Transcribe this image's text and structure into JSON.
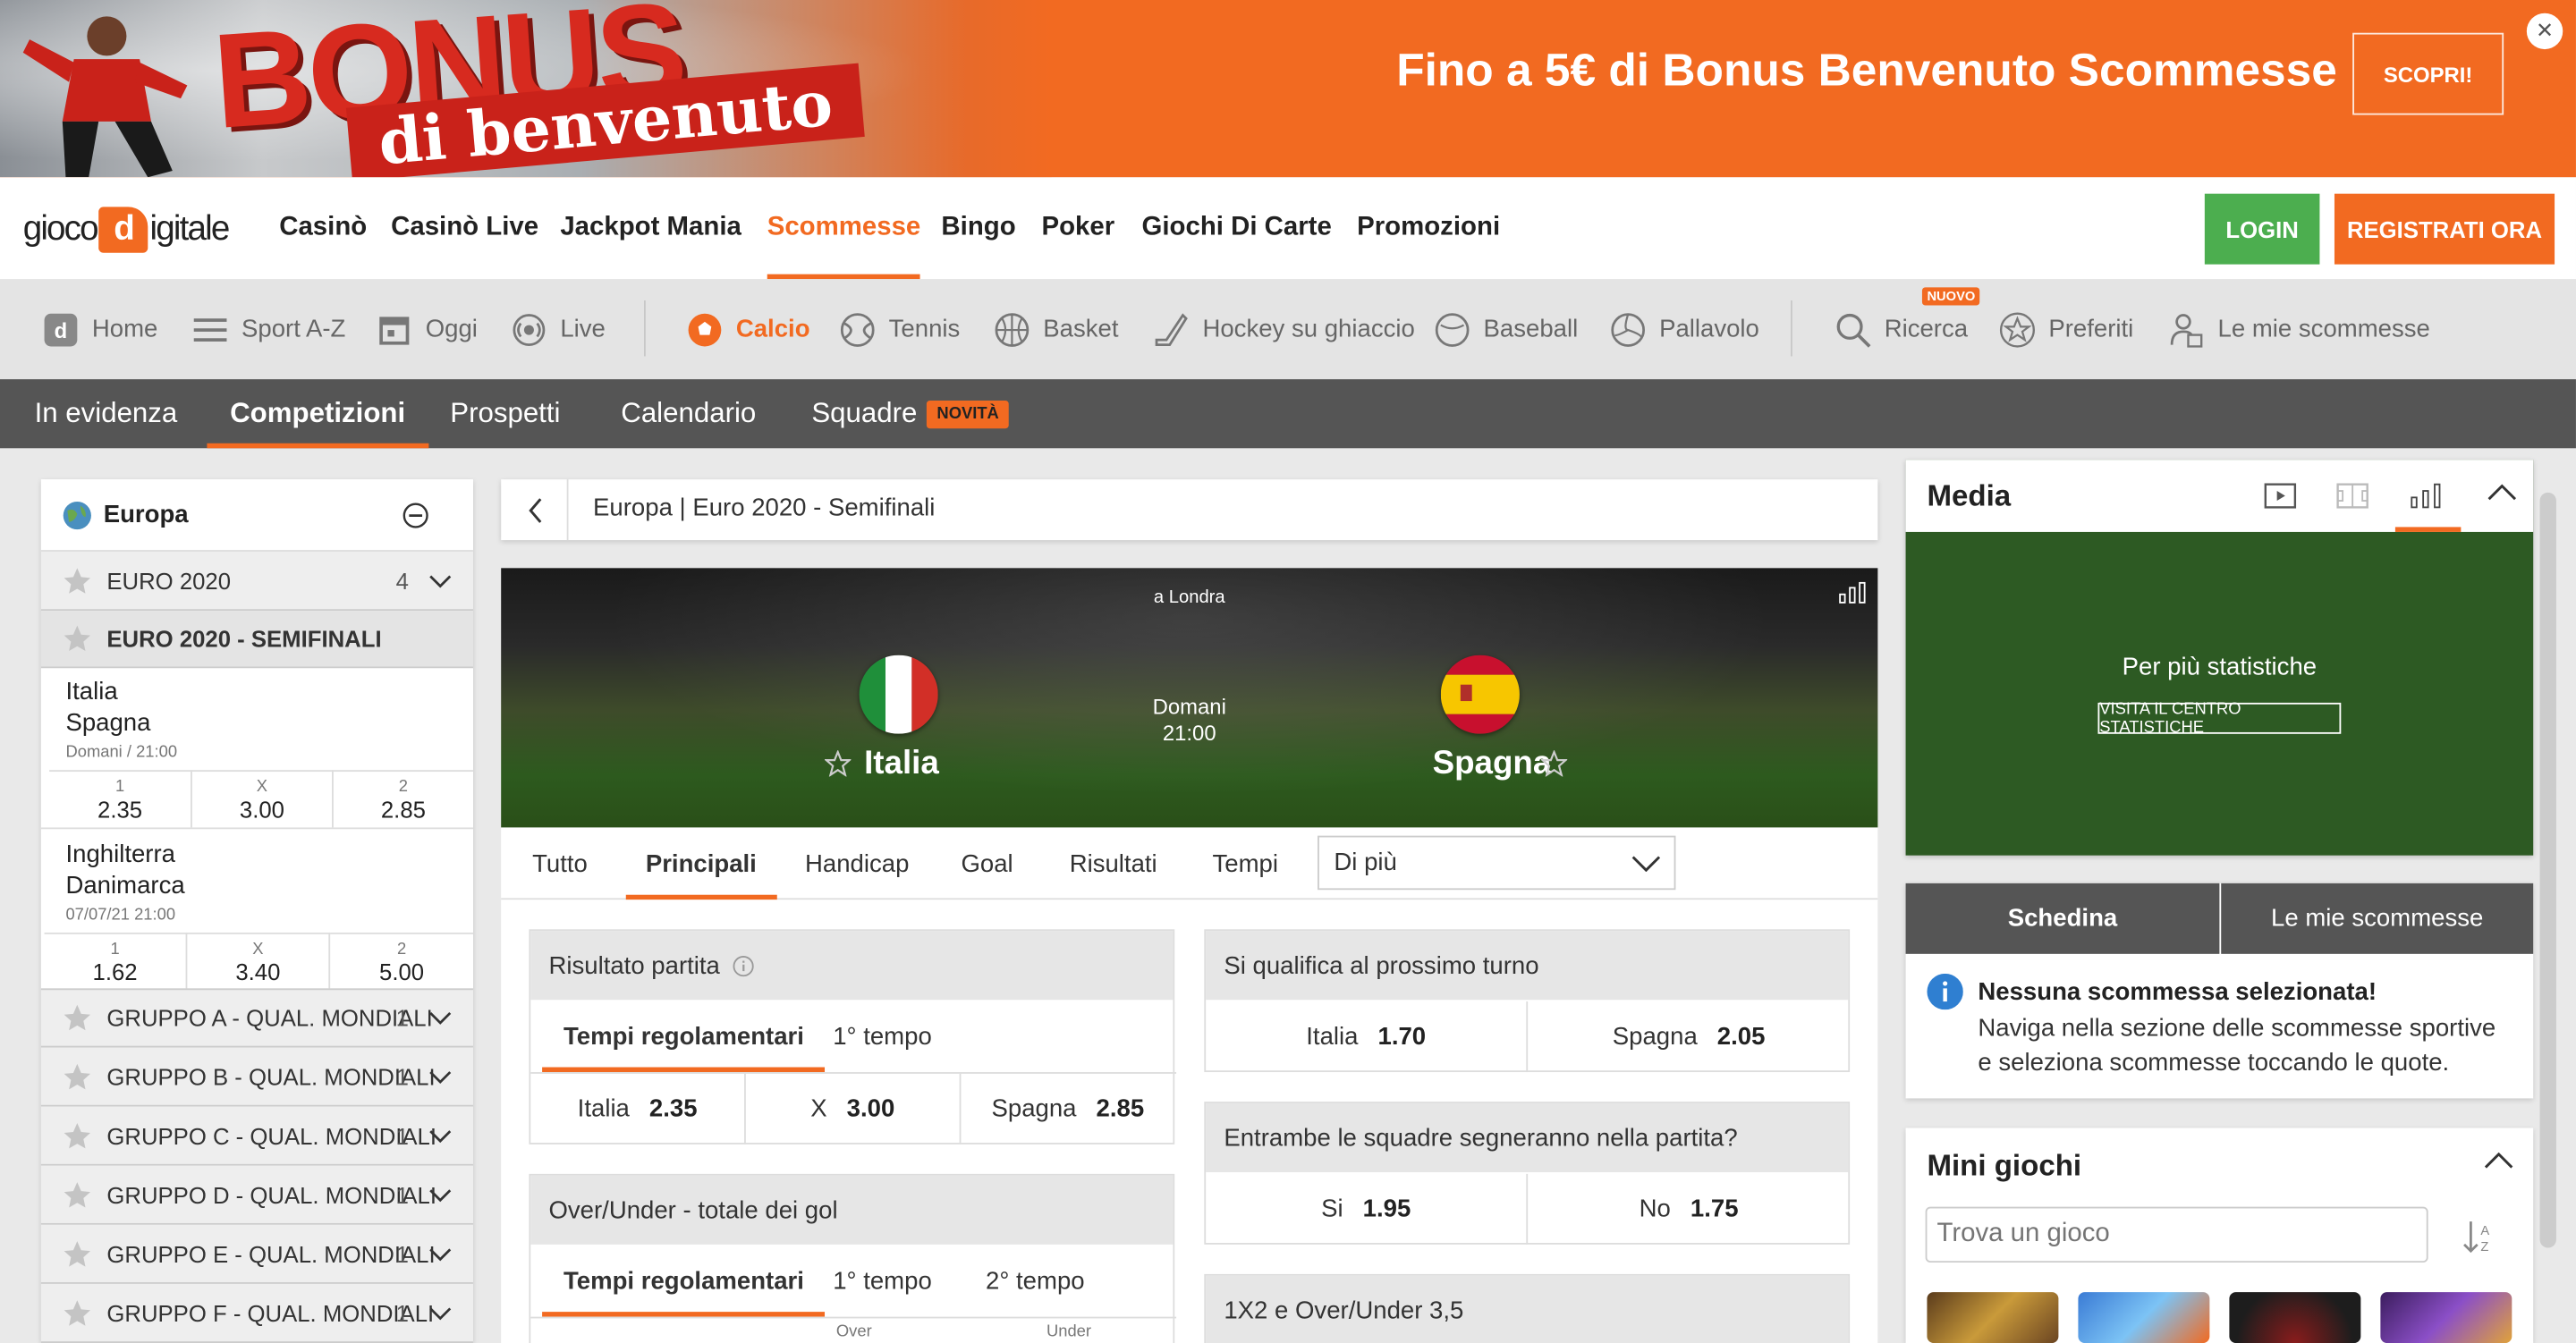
{
  "banner": {
    "title": "Fino a 5€ di Bonus Benvenuto Scommesse",
    "cta": "SCOPRI!",
    "image_big": "BONUS",
    "image_sub": "di benvenuto",
    "close_icon": "close-icon"
  },
  "logo": {
    "part1": "gioco",
    "d": "d",
    "part2": "igitale"
  },
  "main_nav": [
    "Casinò",
    "Casinò Live",
    "Jackpot Mania",
    "Scommesse",
    "Bingo",
    "Poker",
    "Giochi Di Carte",
    "Promozioni"
  ],
  "auth": {
    "login": "LOGIN",
    "register": "REGISTRATI ORA"
  },
  "sport_nav": [
    "Home",
    "Sport A-Z",
    "Oggi",
    "Live",
    "Calcio",
    "Tennis",
    "Basket",
    "Hockey su ghiaccio",
    "Baseball",
    "Pallavolo",
    "Ricerca",
    "Preferiti",
    "Le mie scommesse"
  ],
  "sport_badge": "NUOVO",
  "sub_nav": [
    "In evidenza",
    "Competizioni",
    "Prospetti",
    "Calendario",
    "Squadre"
  ],
  "sub_badge": "NOVITÀ",
  "sidebar": {
    "region": "Europa",
    "comp1": {
      "label": "EURO 2020",
      "count": "4"
    },
    "comp2": {
      "label": "EURO 2020 - SEMIFINALI"
    },
    "matches": [
      {
        "home": "Italia",
        "away": "Spagna",
        "time": "Domani / 21:00",
        "odds": [
          {
            "k": "1",
            "v": "2.35"
          },
          {
            "k": "X",
            "v": "3.00"
          },
          {
            "k": "2",
            "v": "2.85"
          }
        ]
      },
      {
        "home": "Inghilterra",
        "away": "Danimarca",
        "time": "07/07/21 21:00",
        "odds": [
          {
            "k": "1",
            "v": "1.62"
          },
          {
            "k": "X",
            "v": "3.40"
          },
          {
            "k": "2",
            "v": "5.00"
          }
        ]
      }
    ],
    "groups": [
      {
        "label": "GRUPPO A - QUAL. MONDIALI",
        "count": "1"
      },
      {
        "label": "GRUPPO B - QUAL. MONDIALI",
        "count": "1"
      },
      {
        "label": "GRUPPO C - QUAL. MONDIALI",
        "count": "1"
      },
      {
        "label": "GRUPPO D - QUAL. MONDIALI",
        "count": "1"
      },
      {
        "label": "GRUPPO E - QUAL. MONDIALI",
        "count": "1"
      },
      {
        "label": "GRUPPO F - QUAL. MONDIALI",
        "count": "1"
      }
    ]
  },
  "breadcrumb": "Europa | Euro 2020 - Semifinali",
  "event": {
    "venue": "a Londra",
    "home": "Italia",
    "away": "Spagna",
    "day": "Domani",
    "time": "21:00"
  },
  "market_tabs": [
    "Tutto",
    "Principali",
    "Handicap",
    "Goal",
    "Risultati",
    "Tempi"
  ],
  "more_select": "Di più",
  "markets": {
    "result": {
      "title": "Risultato partita",
      "tabs": [
        "Tempi regolamentari",
        "1° tempo"
      ],
      "sels": [
        {
          "n": "Italia",
          "o": "2.35"
        },
        {
          "n": "X",
          "o": "3.00"
        },
        {
          "n": "Spagna",
          "o": "2.85"
        }
      ]
    },
    "overunder": {
      "title": "Over/Under - totale dei gol",
      "tabs": [
        "Tempi regolamentari",
        "1° tempo",
        "2° tempo"
      ],
      "cols": [
        "Over",
        "Under"
      ]
    },
    "qualify": {
      "title": "Si qualifica al prossimo turno",
      "sels": [
        {
          "n": "Italia",
          "o": "1.70"
        },
        {
          "n": "Spagna",
          "o": "2.05"
        }
      ]
    },
    "btts": {
      "title": "Entrambe le squadre segneranno nella partita?",
      "sels": [
        {
          "n": "Si",
          "o": "1.95"
        },
        {
          "n": "No",
          "o": "1.75"
        }
      ]
    },
    "combo": {
      "title": "1X2 e Over/Under 3,5"
    }
  },
  "media": {
    "title": "Media",
    "text": "Per più statistiche",
    "button": "VISITA IL CENTRO STATISTICHE"
  },
  "betslip": {
    "tab1": "Schedina",
    "tab2": "Le mie scommesse",
    "heading": "Nessuna scommessa selezionata!",
    "body": "Naviga nella sezione delle scommesse sportive e seleziona scommesse toccando le quote."
  },
  "mini": {
    "title": "Mini giochi",
    "placeholder": "Trova un gioco"
  },
  "colors": {
    "accent": "#f26a21",
    "green": "#4cae4f",
    "dark_nav": "#555555"
  }
}
